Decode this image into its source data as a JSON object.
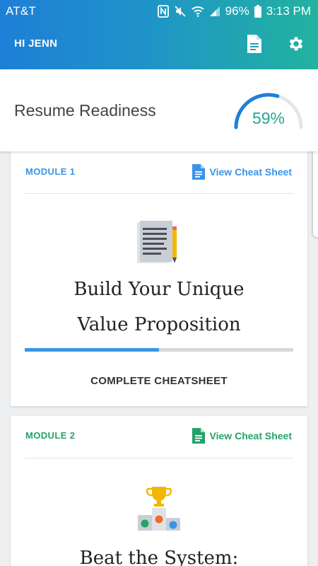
{
  "status_bar": {
    "carrier": "AT&T",
    "battery": "96%",
    "time": "3:13 PM",
    "icons": [
      "nfc-icon",
      "mute-icon",
      "wifi-icon",
      "signal-icon",
      "battery-icon"
    ]
  },
  "app_bar": {
    "greeting": "HI JENN",
    "actions": [
      "document-icon",
      "gear-icon"
    ],
    "gradient": [
      "#1e7fd6",
      "#21b39f"
    ]
  },
  "readiness": {
    "label": "Resume Readiness",
    "percent_text": "59%",
    "percent": 59,
    "gauge_color": "#1e7fd6",
    "value_color": "#25a593"
  },
  "modules": [
    {
      "label": "MODULE 1",
      "cheat_sheet_link": "View Cheat Sheet",
      "title_line1": "Build Your Unique",
      "title_line2": "Value Proposition",
      "progress": 0.5,
      "action": "COMPLETE CHEATSHEET",
      "accent": "#3a94e6",
      "illustration": "document-pencil-icon"
    },
    {
      "label": "MODULE 2",
      "cheat_sheet_link": "View Cheat Sheet",
      "title_line1": "Beat the System:",
      "accent": "#25a26a",
      "illustration": "trophy-podium-icon"
    }
  ]
}
